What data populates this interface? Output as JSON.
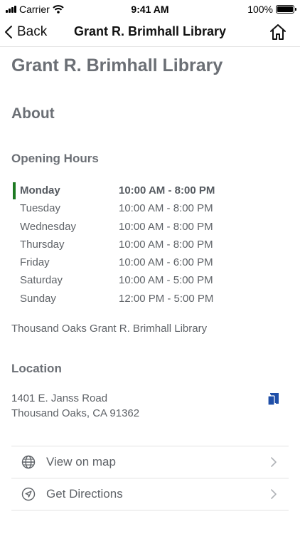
{
  "status_bar": {
    "carrier": "Carrier",
    "time": "9:41 AM",
    "battery": "100%",
    "icons": [
      "signal-icon",
      "wifi-icon",
      "battery-icon"
    ]
  },
  "nav": {
    "back_label": "Back",
    "title": "Grant R. Brimhall Library",
    "back_icon": "chevron-left-icon",
    "home_icon": "home-icon"
  },
  "page": {
    "title": "Grant R. Brimhall Library",
    "about_heading": "About",
    "hours_heading": "Opening Hours",
    "hours": [
      {
        "day": "Monday",
        "time": "10:00 AM - 8:00 PM",
        "today": true
      },
      {
        "day": "Tuesday",
        "time": "10:00 AM - 8:00 PM",
        "today": false
      },
      {
        "day": "Wednesday",
        "time": "10:00 AM - 8:00 PM",
        "today": false
      },
      {
        "day": "Thursday",
        "time": "10:00 AM - 8:00 PM",
        "today": false
      },
      {
        "day": "Friday",
        "time": "10:00 AM - 6:00 PM",
        "today": false
      },
      {
        "day": "Saturday",
        "time": "10:00 AM - 5:00 PM",
        "today": false
      },
      {
        "day": "Sunday",
        "time": "12:00 PM - 5:00 PM",
        "today": false
      }
    ],
    "library_name": "Thousand Oaks Grant R. Brimhall Library",
    "location_heading": "Location",
    "address_line1": "1401 E. Janss Road",
    "address_line2": "Thousand Oaks, CA 91362",
    "copy_icon": "copy-icon",
    "actions": [
      {
        "label": "View on map",
        "icon": "globe-icon"
      },
      {
        "label": "Get Directions",
        "icon": "navigation-arrow-icon"
      }
    ]
  },
  "colors": {
    "today_marker": "#1d7a22",
    "copy_icon": "#1f4fa8",
    "text": "#5f6368",
    "heading": "#6b6f75"
  }
}
